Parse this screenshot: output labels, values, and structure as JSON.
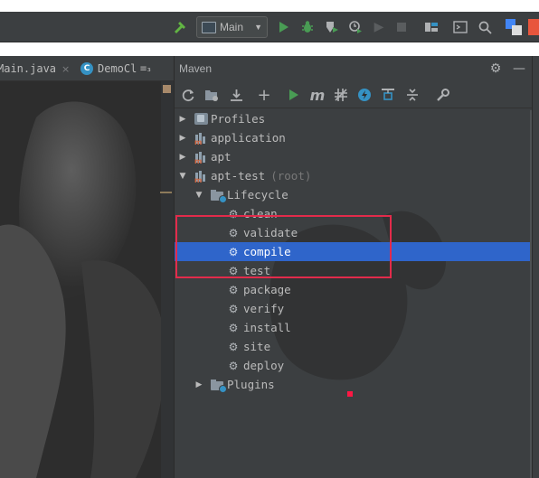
{
  "toolbar": {
    "run_config": "Main",
    "icons": [
      "build-hammer-icon",
      "run-icon",
      "debug-icon",
      "coverage-icon",
      "profile-icon",
      "attach-icon",
      "stop-icon",
      "project-structure-icon",
      "terminal-icon",
      "search-icon",
      "translate-icon"
    ]
  },
  "editor": {
    "tabs": [
      {
        "label": "Main.java",
        "close": "×"
      },
      {
        "label": "DemoCl",
        "close": ""
      }
    ],
    "tab_overflow": "≡₃"
  },
  "maven": {
    "title": "Maven",
    "toolbar_icons": [
      "reload-icon",
      "add-project-icon",
      "download-icon",
      "plus-icon",
      "run-icon",
      "execute-goal-icon",
      "toggle-offline-icon",
      "skip-tests-icon",
      "show-dependencies-icon",
      "collapse-all-icon",
      "settings-wrench-icon"
    ],
    "tree": [
      {
        "label": "Profiles",
        "kind": "profiles",
        "expanded": false,
        "level": 0
      },
      {
        "label": "application",
        "kind": "project",
        "expanded": false,
        "level": 0
      },
      {
        "label": "apt",
        "kind": "project",
        "expanded": false,
        "level": 0
      },
      {
        "label": "apt-test",
        "tag": "(root)",
        "kind": "project",
        "expanded": true,
        "level": 0
      },
      {
        "label": "Lifecycle",
        "kind": "folder",
        "expanded": true,
        "level": 1
      },
      {
        "label": "clean",
        "kind": "goal",
        "level": 2
      },
      {
        "label": "validate",
        "kind": "goal",
        "level": 2
      },
      {
        "label": "compile",
        "kind": "goal",
        "level": 2,
        "selected": true
      },
      {
        "label": "test",
        "kind": "goal",
        "level": 2
      },
      {
        "label": "package",
        "kind": "goal",
        "level": 2
      },
      {
        "label": "verify",
        "kind": "goal",
        "level": 2
      },
      {
        "label": "install",
        "kind": "goal",
        "level": 2
      },
      {
        "label": "site",
        "kind": "goal",
        "level": 2
      },
      {
        "label": "deploy",
        "kind": "goal",
        "level": 2
      },
      {
        "label": "Plugins",
        "kind": "folder",
        "expanded": false,
        "level": 1
      }
    ]
  },
  "colors": {
    "panel_bg": "#3c3f41",
    "selection": "#2f65ca",
    "highlight_box": "#e32b4b",
    "run_green": "#499c54"
  }
}
